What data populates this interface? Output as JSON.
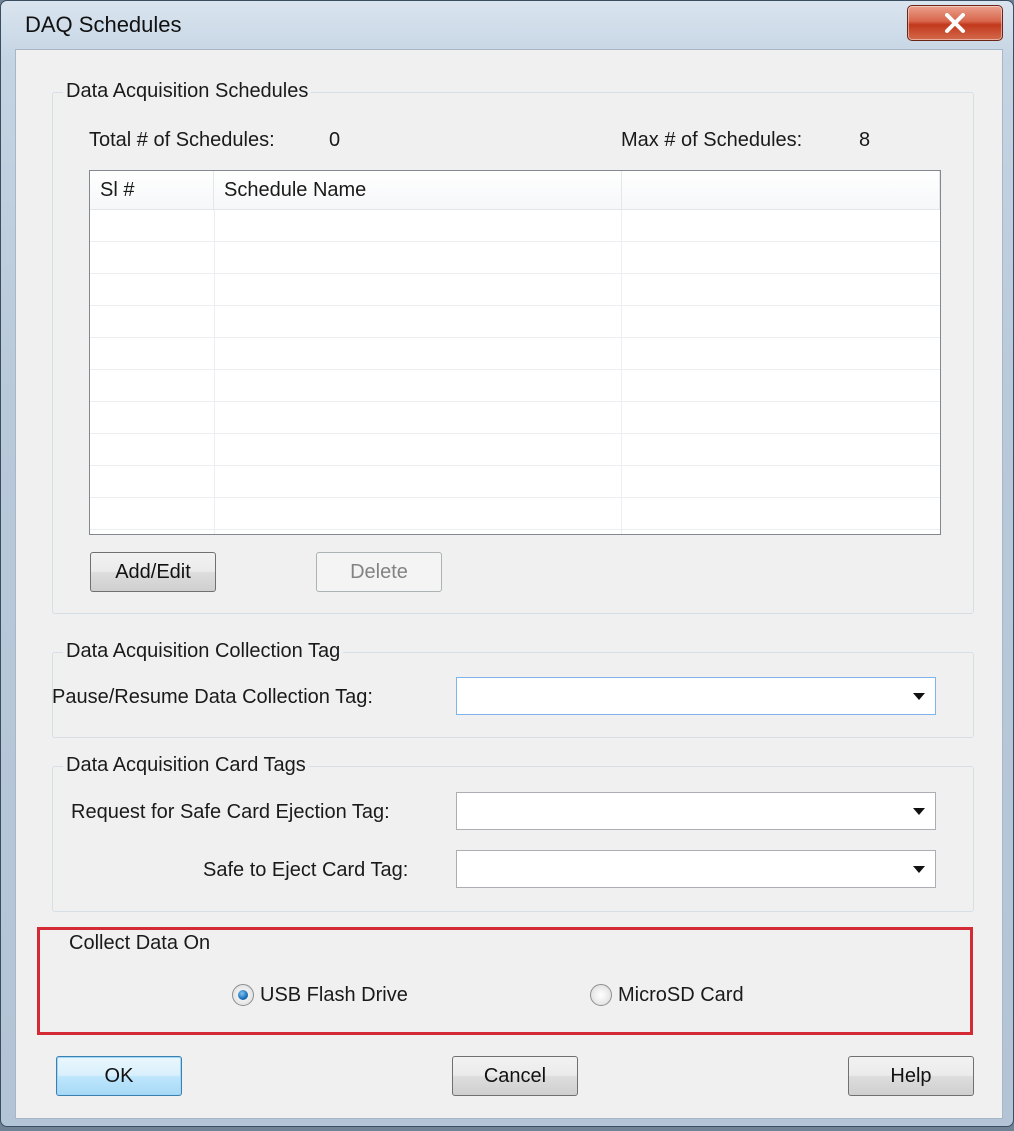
{
  "window": {
    "title": "DAQ Schedules"
  },
  "schedules": {
    "group_label": "Data Acquisition Schedules",
    "total_label": "Total # of Schedules:",
    "total_value": "0",
    "max_label": "Max # of Schedules:",
    "max_value": "8",
    "columns": [
      "Sl #",
      "Schedule Name",
      ""
    ],
    "rows": [],
    "add_edit_label": "Add/Edit",
    "delete_label": "Delete"
  },
  "collection_tag": {
    "group_label": "Data Acquisition Collection Tag",
    "pause_resume_label": "Pause/Resume Data Collection Tag:",
    "pause_resume_value": ""
  },
  "card_tags": {
    "group_label": "Data Acquisition Card Tags",
    "request_label": "Request for Safe Card Ejection Tag:",
    "request_value": "",
    "safe_label": "Safe to Eject Card Tag:",
    "safe_value": ""
  },
  "collect_on": {
    "group_label": "Collect Data On",
    "options": [
      "USB Flash Drive",
      "MicroSD Card"
    ],
    "selected": "USB Flash Drive"
  },
  "footer": {
    "ok_label": "OK",
    "cancel_label": "Cancel",
    "help_label": "Help"
  },
  "colors": {
    "highlight": "#d42a35",
    "close_button": "#c2391c"
  }
}
